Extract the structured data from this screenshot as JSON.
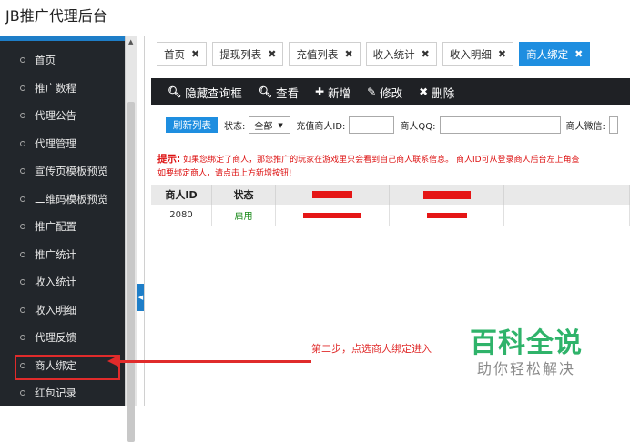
{
  "app_title": "JB推广代理后台",
  "sidebar": {
    "items": [
      {
        "label": "首页"
      },
      {
        "label": "推广数程"
      },
      {
        "label": "代理公告"
      },
      {
        "label": "代理管理"
      },
      {
        "label": "宣传页模板预览"
      },
      {
        "label": "二维码模板预览"
      },
      {
        "label": "推广配置"
      },
      {
        "label": "推广统计"
      },
      {
        "label": "收入统计"
      },
      {
        "label": "收入明细"
      },
      {
        "label": "代理反馈"
      },
      {
        "label": "商人绑定",
        "active": true
      },
      {
        "label": "红包记录"
      }
    ]
  },
  "tabs": [
    {
      "label": "首页"
    },
    {
      "label": "提现列表"
    },
    {
      "label": "充值列表"
    },
    {
      "label": "收入统计"
    },
    {
      "label": "收入明细"
    },
    {
      "label": "商人绑定",
      "active": true
    }
  ],
  "toolbar": {
    "hide_search": "隐藏查询框",
    "view": "查看",
    "add": "新增",
    "edit": "修改",
    "delete": "删除"
  },
  "filter": {
    "refresh": "刷新列表",
    "status_label": "状态:",
    "status_value": "全部",
    "merchant_id_label": "充值商人ID:",
    "merchant_qq_label": "商人QQ:",
    "merchant_wechat_label": "商人微信:"
  },
  "notice": {
    "lead": "提示:",
    "line1": "如果您绑定了商人，那您推广的玩家在游戏里只会看到自己商人联系信息。 商人ID可从登录商人后台左上角查",
    "line2": "如要绑定商人，请点击上方新增按钮!"
  },
  "table": {
    "headers": [
      "商人ID",
      "状态",
      "",
      "",
      ""
    ],
    "rows": [
      {
        "merchant_id": "2080",
        "status": "启用"
      }
    ]
  },
  "annotation": {
    "step_text": "第二步，点选商人绑定进入"
  },
  "watermark": {
    "main": "百科全说",
    "sub": "助你轻松解决"
  },
  "colors": {
    "accent": "#1e8ee0",
    "sidebar_bg": "#22262b",
    "highlight_red": "#e02b2b",
    "watermark_green": "#2fb36a"
  }
}
